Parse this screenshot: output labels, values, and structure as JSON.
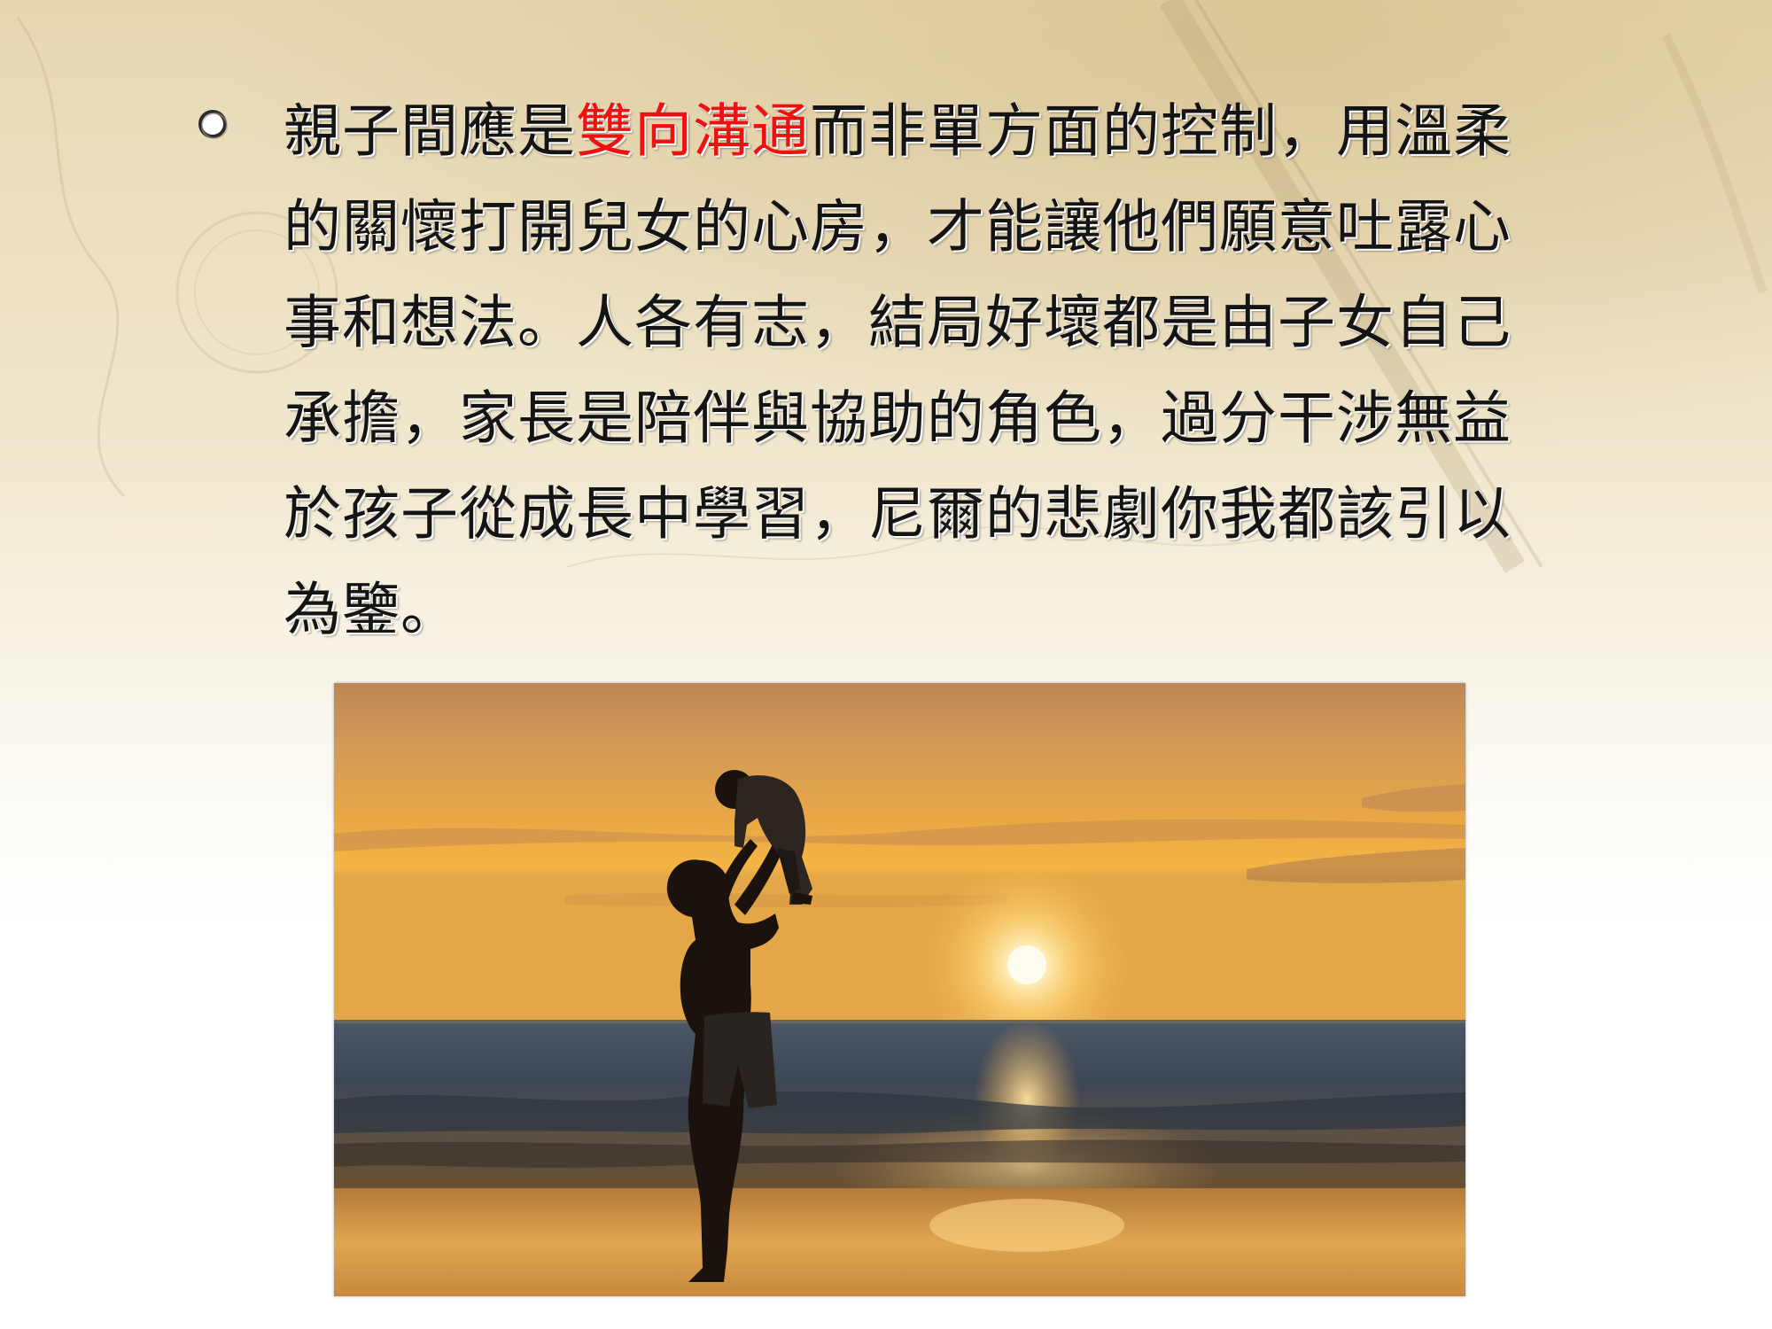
{
  "slide": {
    "bullet_icon": "hollow-circle-bullet-icon",
    "paragraph": {
      "before": "親子間應是",
      "highlight": "雙向溝通",
      "after": "而非單方面的控制，用溫柔的關懷打開兒女的心房，才能讓他們願意吐露心事和想法。人各有志，結局好壞都是由子女自己承擔，家長是陪伴與協助的角色，過分干涉無益於孩子從成長中學習，尼爾的悲劇你我都該引以為鑒。"
    },
    "colors": {
      "text": "#141414",
      "highlight": "#ef1010",
      "background_tint": "#eadfc0",
      "sky_top": "#c9935c",
      "sky_sun": "#f6b445",
      "sea": "#3e4a57"
    },
    "image": {
      "subject": "silhouette of a parent lifting a baby at sunset on a beach"
    }
  }
}
